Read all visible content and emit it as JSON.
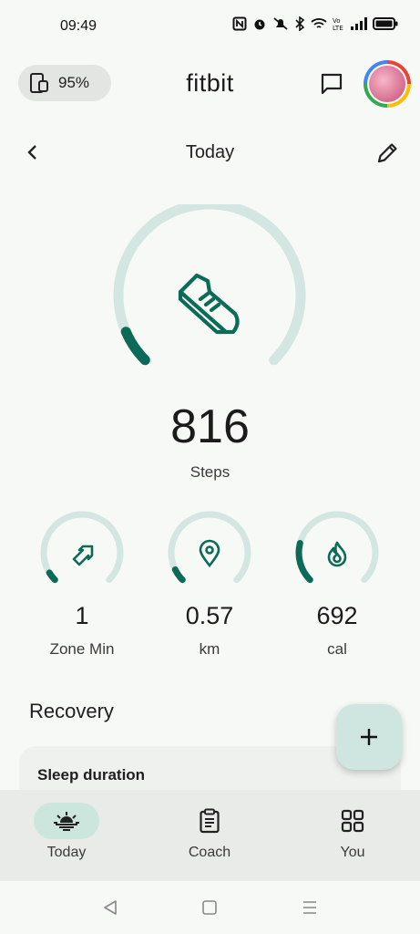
{
  "status_bar": {
    "time": "09:49"
  },
  "header": {
    "battery": "95%",
    "logo": "fitbit"
  },
  "date_nav": {
    "title": "Today"
  },
  "steps": {
    "value": "816",
    "label": "Steps",
    "progress": 0.08
  },
  "metrics": [
    {
      "value": "1",
      "label": "Zone Min",
      "progress": 0.05,
      "icon": "zone-arrows-icon"
    },
    {
      "value": "0.57",
      "label": "km",
      "progress": 0.07,
      "icon": "location-pin-icon"
    },
    {
      "value": "692",
      "label": "cal",
      "progress": 0.22,
      "icon": "flame-icon"
    }
  ],
  "recovery": {
    "title": "Recovery",
    "card_title": "Sleep duration"
  },
  "fab": {
    "label": "+"
  },
  "bottom_nav": [
    {
      "label": "Today",
      "active": true,
      "icon": "sunrise-icon"
    },
    {
      "label": "Coach",
      "active": false,
      "icon": "clipboard-icon"
    },
    {
      "label": "You",
      "active": false,
      "icon": "grid-icon"
    }
  ],
  "colors": {
    "accent": "#0b6b57",
    "ring_track": "#d3e6e1",
    "fab": "#cfe5df",
    "nav_active": "#cce6de"
  }
}
